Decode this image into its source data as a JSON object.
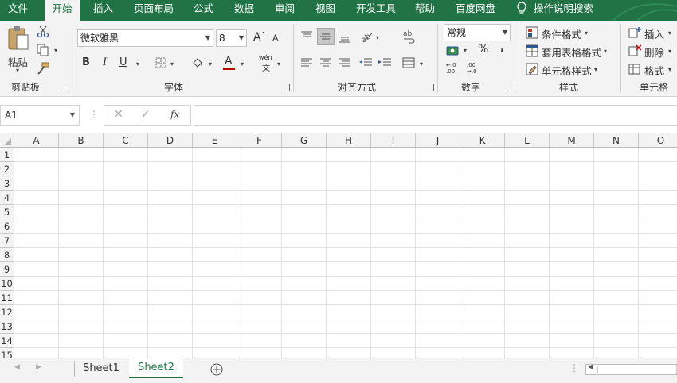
{
  "menu": {
    "tabs": [
      "文件",
      "开始",
      "插入",
      "页面布局",
      "公式",
      "数据",
      "审阅",
      "视图",
      "开发工具",
      "帮助",
      "百度网盘"
    ],
    "active_index": 1,
    "search": "操作说明搜索"
  },
  "ribbon": {
    "clipboard": {
      "paste": "粘贴",
      "label": "剪贴板"
    },
    "font": {
      "name": "微软雅黑",
      "size": "8",
      "bold": "B",
      "italic": "I",
      "underline": "U",
      "grow": "A",
      "shrink": "A",
      "color_letter": "A",
      "phonetic": "wén",
      "phonetic_char": "文",
      "label": "字体"
    },
    "alignment": {
      "label": "对齐方式"
    },
    "number": {
      "format": "常规",
      "percent": "%",
      "comma": ",",
      "inc_decimal": "←.0 .00",
      "dec_decimal": ".00 →.0",
      "label": "数字"
    },
    "styles": {
      "conditional": "条件格式",
      "table": "套用表格格式",
      "cell": "单元格样式",
      "label": "样式"
    },
    "cells": {
      "insert": "插入",
      "delete": "删除",
      "format": "格式",
      "label": "单元格"
    }
  },
  "formula_bar": {
    "name_box": "A1",
    "fx": "fx",
    "formula": ""
  },
  "grid": {
    "columns": [
      "A",
      "B",
      "C",
      "D",
      "E",
      "F",
      "G",
      "H",
      "I",
      "J",
      "K",
      "L",
      "M",
      "N",
      "O"
    ],
    "rows": [
      "1",
      "2",
      "3",
      "4",
      "5",
      "6",
      "7",
      "8",
      "9",
      "10",
      "11",
      "12",
      "13",
      "14",
      "15"
    ]
  },
  "sheets": {
    "tabs": [
      "Sheet1",
      "Sheet2"
    ],
    "active_index": 1
  },
  "colors": {
    "accent": "#217346",
    "ribbon_bg": "#f3f3f3",
    "font_color_bar": "#c00000"
  }
}
